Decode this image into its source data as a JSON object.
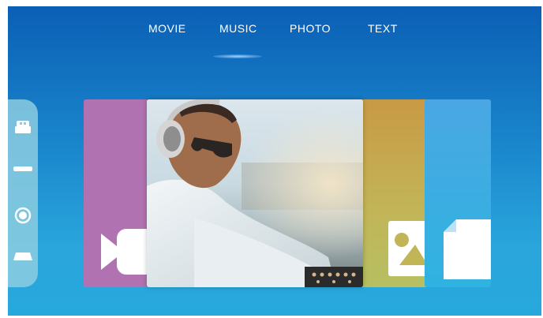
{
  "tabs": [
    {
      "label": "MOVIE"
    },
    {
      "label": "MUSIC",
      "active": true
    },
    {
      "label": "PHOTO"
    },
    {
      "label": "TEXT"
    }
  ],
  "sidebar": {
    "items": [
      {
        "icon": "device-icon"
      },
      {
        "icon": "drive-icon"
      },
      {
        "icon": "disc-icon"
      },
      {
        "icon": "storage-icon"
      }
    ]
  },
  "carousel": {
    "cards": [
      {
        "kind": "movie",
        "color": "#b072b0",
        "icon": "video-camera-icon"
      },
      {
        "kind": "music",
        "image": "man-with-headphones-dj-photo"
      },
      {
        "kind": "photo",
        "color": "#c2b558",
        "icon": "photo-icon"
      },
      {
        "kind": "text",
        "color": "#35aee2",
        "icon": "document-icon"
      }
    ]
  },
  "colors": {
    "background_top": "#0b5fb5",
    "background_bottom": "#27a8dd",
    "sidebar": "#8ccde1",
    "tab_text": "#ffffff"
  }
}
